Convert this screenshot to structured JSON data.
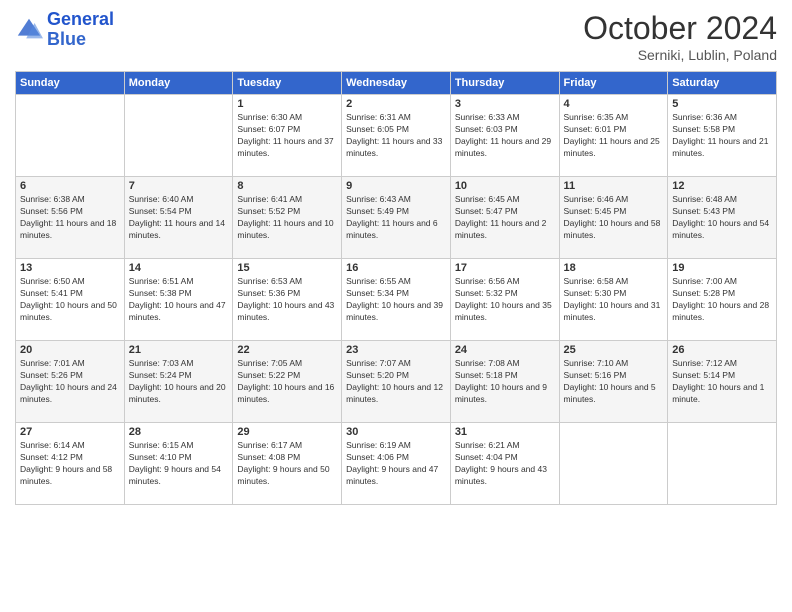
{
  "logo": {
    "line1": "General",
    "line2": "Blue"
  },
  "title": "October 2024",
  "subtitle": "Serniki, Lublin, Poland",
  "days_of_week": [
    "Sunday",
    "Monday",
    "Tuesday",
    "Wednesday",
    "Thursday",
    "Friday",
    "Saturday"
  ],
  "weeks": [
    [
      {
        "day": "",
        "sunrise": "",
        "sunset": "",
        "daylight": ""
      },
      {
        "day": "",
        "sunrise": "",
        "sunset": "",
        "daylight": ""
      },
      {
        "day": "1",
        "sunrise": "Sunrise: 6:30 AM",
        "sunset": "Sunset: 6:07 PM",
        "daylight": "Daylight: 11 hours and 37 minutes."
      },
      {
        "day": "2",
        "sunrise": "Sunrise: 6:31 AM",
        "sunset": "Sunset: 6:05 PM",
        "daylight": "Daylight: 11 hours and 33 minutes."
      },
      {
        "day": "3",
        "sunrise": "Sunrise: 6:33 AM",
        "sunset": "Sunset: 6:03 PM",
        "daylight": "Daylight: 11 hours and 29 minutes."
      },
      {
        "day": "4",
        "sunrise": "Sunrise: 6:35 AM",
        "sunset": "Sunset: 6:01 PM",
        "daylight": "Daylight: 11 hours and 25 minutes."
      },
      {
        "day": "5",
        "sunrise": "Sunrise: 6:36 AM",
        "sunset": "Sunset: 5:58 PM",
        "daylight": "Daylight: 11 hours and 21 minutes."
      }
    ],
    [
      {
        "day": "6",
        "sunrise": "Sunrise: 6:38 AM",
        "sunset": "Sunset: 5:56 PM",
        "daylight": "Daylight: 11 hours and 18 minutes."
      },
      {
        "day": "7",
        "sunrise": "Sunrise: 6:40 AM",
        "sunset": "Sunset: 5:54 PM",
        "daylight": "Daylight: 11 hours and 14 minutes."
      },
      {
        "day": "8",
        "sunrise": "Sunrise: 6:41 AM",
        "sunset": "Sunset: 5:52 PM",
        "daylight": "Daylight: 11 hours and 10 minutes."
      },
      {
        "day": "9",
        "sunrise": "Sunrise: 6:43 AM",
        "sunset": "Sunset: 5:49 PM",
        "daylight": "Daylight: 11 hours and 6 minutes."
      },
      {
        "day": "10",
        "sunrise": "Sunrise: 6:45 AM",
        "sunset": "Sunset: 5:47 PM",
        "daylight": "Daylight: 11 hours and 2 minutes."
      },
      {
        "day": "11",
        "sunrise": "Sunrise: 6:46 AM",
        "sunset": "Sunset: 5:45 PM",
        "daylight": "Daylight: 10 hours and 58 minutes."
      },
      {
        "day": "12",
        "sunrise": "Sunrise: 6:48 AM",
        "sunset": "Sunset: 5:43 PM",
        "daylight": "Daylight: 10 hours and 54 minutes."
      }
    ],
    [
      {
        "day": "13",
        "sunrise": "Sunrise: 6:50 AM",
        "sunset": "Sunset: 5:41 PM",
        "daylight": "Daylight: 10 hours and 50 minutes."
      },
      {
        "day": "14",
        "sunrise": "Sunrise: 6:51 AM",
        "sunset": "Sunset: 5:38 PM",
        "daylight": "Daylight: 10 hours and 47 minutes."
      },
      {
        "day": "15",
        "sunrise": "Sunrise: 6:53 AM",
        "sunset": "Sunset: 5:36 PM",
        "daylight": "Daylight: 10 hours and 43 minutes."
      },
      {
        "day": "16",
        "sunrise": "Sunrise: 6:55 AM",
        "sunset": "Sunset: 5:34 PM",
        "daylight": "Daylight: 10 hours and 39 minutes."
      },
      {
        "day": "17",
        "sunrise": "Sunrise: 6:56 AM",
        "sunset": "Sunset: 5:32 PM",
        "daylight": "Daylight: 10 hours and 35 minutes."
      },
      {
        "day": "18",
        "sunrise": "Sunrise: 6:58 AM",
        "sunset": "Sunset: 5:30 PM",
        "daylight": "Daylight: 10 hours and 31 minutes."
      },
      {
        "day": "19",
        "sunrise": "Sunrise: 7:00 AM",
        "sunset": "Sunset: 5:28 PM",
        "daylight": "Daylight: 10 hours and 28 minutes."
      }
    ],
    [
      {
        "day": "20",
        "sunrise": "Sunrise: 7:01 AM",
        "sunset": "Sunset: 5:26 PM",
        "daylight": "Daylight: 10 hours and 24 minutes."
      },
      {
        "day": "21",
        "sunrise": "Sunrise: 7:03 AM",
        "sunset": "Sunset: 5:24 PM",
        "daylight": "Daylight: 10 hours and 20 minutes."
      },
      {
        "day": "22",
        "sunrise": "Sunrise: 7:05 AM",
        "sunset": "Sunset: 5:22 PM",
        "daylight": "Daylight: 10 hours and 16 minutes."
      },
      {
        "day": "23",
        "sunrise": "Sunrise: 7:07 AM",
        "sunset": "Sunset: 5:20 PM",
        "daylight": "Daylight: 10 hours and 12 minutes."
      },
      {
        "day": "24",
        "sunrise": "Sunrise: 7:08 AM",
        "sunset": "Sunset: 5:18 PM",
        "daylight": "Daylight: 10 hours and 9 minutes."
      },
      {
        "day": "25",
        "sunrise": "Sunrise: 7:10 AM",
        "sunset": "Sunset: 5:16 PM",
        "daylight": "Daylight: 10 hours and 5 minutes."
      },
      {
        "day": "26",
        "sunrise": "Sunrise: 7:12 AM",
        "sunset": "Sunset: 5:14 PM",
        "daylight": "Daylight: 10 hours and 1 minute."
      }
    ],
    [
      {
        "day": "27",
        "sunrise": "Sunrise: 6:14 AM",
        "sunset": "Sunset: 4:12 PM",
        "daylight": "Daylight: 9 hours and 58 minutes."
      },
      {
        "day": "28",
        "sunrise": "Sunrise: 6:15 AM",
        "sunset": "Sunset: 4:10 PM",
        "daylight": "Daylight: 9 hours and 54 minutes."
      },
      {
        "day": "29",
        "sunrise": "Sunrise: 6:17 AM",
        "sunset": "Sunset: 4:08 PM",
        "daylight": "Daylight: 9 hours and 50 minutes."
      },
      {
        "day": "30",
        "sunrise": "Sunrise: 6:19 AM",
        "sunset": "Sunset: 4:06 PM",
        "daylight": "Daylight: 9 hours and 47 minutes."
      },
      {
        "day": "31",
        "sunrise": "Sunrise: 6:21 AM",
        "sunset": "Sunset: 4:04 PM",
        "daylight": "Daylight: 9 hours and 43 minutes."
      },
      {
        "day": "",
        "sunrise": "",
        "sunset": "",
        "daylight": ""
      },
      {
        "day": "",
        "sunrise": "",
        "sunset": "",
        "daylight": ""
      }
    ]
  ]
}
